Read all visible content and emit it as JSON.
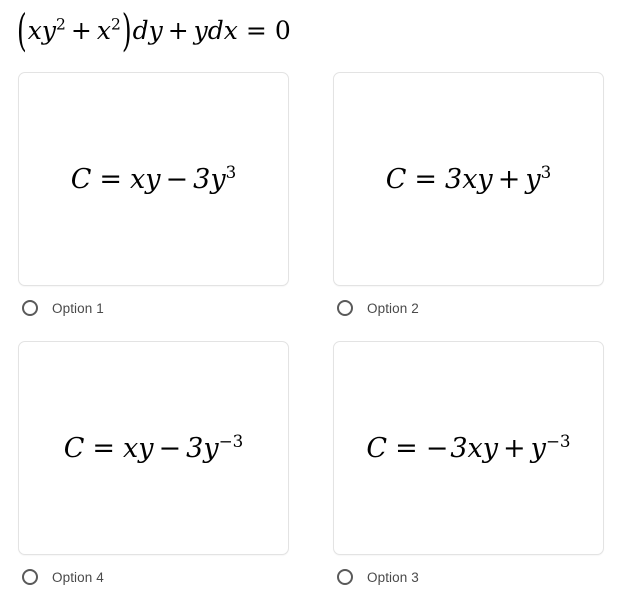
{
  "question": {
    "equation_plain": "(xy^2 + x^2)dy + ydx = 0",
    "equation_parts": {
      "open_paren": "(",
      "term1_base": "xy",
      "term1_exp": "2",
      "plus": "+",
      "term2_base": "x",
      "term2_exp": "2",
      "close_paren": ")",
      "dy": "dy",
      "plus2": "+",
      "ydx": "ydx",
      "equals": "=",
      "zero": "0"
    }
  },
  "options": [
    {
      "id": "option-1",
      "label": "Option 1",
      "formula_plain": "C = xy - 3y^3",
      "lhs": "C",
      "equals": "=",
      "terms": [
        {
          "sign": "",
          "base": "xy",
          "exp": ""
        },
        {
          "sign": "−",
          "base": "3y",
          "exp": "3"
        }
      ],
      "selected": false
    },
    {
      "id": "option-2",
      "label": "Option 2",
      "formula_plain": "C = 3xy + y^3",
      "lhs": "C",
      "equals": "=",
      "terms": [
        {
          "sign": "",
          "base": "3xy",
          "exp": ""
        },
        {
          "sign": "+",
          "base": "y",
          "exp": "3"
        }
      ],
      "selected": false
    },
    {
      "id": "option-4",
      "label": "Option 4",
      "formula_plain": "C = xy - 3y^-3",
      "lhs": "C",
      "equals": "=",
      "terms": [
        {
          "sign": "",
          "base": "xy",
          "exp": ""
        },
        {
          "sign": "−",
          "base": "3y",
          "exp": "−3"
        }
      ],
      "selected": false
    },
    {
      "id": "option-3",
      "label": "Option 3",
      "formula_plain": "C = -3xy + y^-3",
      "lhs": "C",
      "equals": "=",
      "terms": [
        {
          "sign": "−",
          "base": "3xy",
          "exp": "",
          "leading": true
        },
        {
          "sign": "+",
          "base": "y",
          "exp": "−3"
        }
      ],
      "selected": false
    }
  ],
  "style": {
    "page_background": "#ffffff",
    "card_background": "#ffffff",
    "card_border": "#e3e3e3",
    "math_color": "#000000",
    "label_color": "#4a4a4a",
    "radio_color": "#5a5a5a"
  }
}
